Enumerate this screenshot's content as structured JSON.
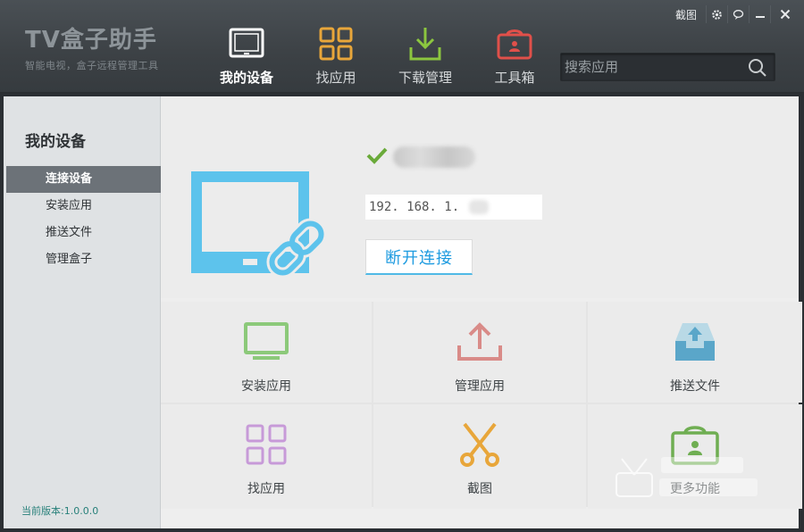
{
  "app": {
    "title": "TV盒子助手",
    "subtitle": "智能电视，盒子远程管理工具"
  },
  "window_controls": {
    "screenshot_label": "截图",
    "icons": [
      "gear-icon",
      "chat-icon",
      "minimize-icon",
      "close-icon"
    ]
  },
  "nav": {
    "items": [
      {
        "label": "我的设备",
        "icon": "tv-icon",
        "color": "#ffffff",
        "active": true
      },
      {
        "label": "找应用",
        "icon": "app-grid-icon",
        "color": "#e8a63a",
        "active": false
      },
      {
        "label": "下载管理",
        "icon": "download-icon",
        "color": "#8cc63f",
        "active": false
      },
      {
        "label": "工具箱",
        "icon": "toolbox-icon",
        "color": "#e0504a",
        "active": false
      }
    ]
  },
  "search": {
    "placeholder": "搜索应用",
    "icon": "search-icon"
  },
  "sidebar": {
    "title": "我的设备",
    "items": [
      {
        "label": "连接设备",
        "active": true
      },
      {
        "label": "安装应用",
        "active": false
      },
      {
        "label": "推送文件",
        "active": false
      },
      {
        "label": "管理盒子",
        "active": false
      }
    ],
    "version_label": "当前版本:",
    "version_value": "1.0.0.0"
  },
  "device": {
    "connected": true,
    "ip_prefix": "192. 168. 1. ",
    "disconnect_label": "断开连接"
  },
  "tiles": [
    {
      "label": "安装应用",
      "icon": "install-tv-icon",
      "color": "#8cc97a"
    },
    {
      "label": "管理应用",
      "icon": "upload-icon",
      "color": "#d98b88"
    },
    {
      "label": "推送文件",
      "icon": "inbox-upload-icon",
      "color": "#5aa6c9"
    },
    {
      "label": "找应用",
      "icon": "app-grid-icon",
      "color": "#c79ad8"
    },
    {
      "label": "截图",
      "icon": "scissors-icon",
      "color": "#e8a63a"
    },
    {
      "label": "更多功能",
      "icon": "toolbox-icon",
      "color": "#6fae52"
    }
  ],
  "colors": {
    "accent": "#1e9be0",
    "header": "#3c4145",
    "sidebar_active": "#6c7278",
    "check": "#6aaa3a"
  }
}
